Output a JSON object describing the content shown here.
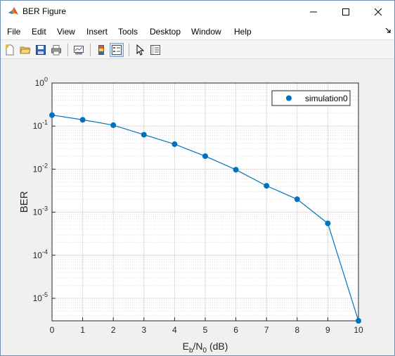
{
  "window": {
    "title": "BER Figure"
  },
  "menu": [
    "File",
    "Edit",
    "View",
    "Insert",
    "Tools",
    "Desktop",
    "Window",
    "Help"
  ],
  "toolbar": [
    "new-figure-icon",
    "open-file-icon",
    "save-icon",
    "print-icon",
    "link-plot-icon",
    "colorbar-icon",
    "legend-icon",
    "pointer-icon",
    "property-inspector-icon"
  ],
  "colors": {
    "series": "#0072bd",
    "grid": "#dcdcdc"
  },
  "chart_data": {
    "type": "line",
    "xlabel": "E_b/N_0 (dB)",
    "xlabel_parts": {
      "e": "E",
      "b": "b",
      "slash": "/N",
      "zero": "0",
      "unit": " (dB)"
    },
    "ylabel": "BER",
    "yscale": "log",
    "xlim": [
      0,
      10
    ],
    "ylim": [
      3e-06,
      1
    ],
    "xticks": [
      "0",
      "1",
      "2",
      "3",
      "4",
      "5",
      "6",
      "7",
      "8",
      "9",
      "10"
    ],
    "yticks": [
      {
        "base": "10",
        "exp": "0",
        "value": 1
      },
      {
        "base": "10",
        "exp": "-1",
        "value": 0.1
      },
      {
        "base": "10",
        "exp": "-2",
        "value": 0.01
      },
      {
        "base": "10",
        "exp": "-3",
        "value": 0.001
      },
      {
        "base": "10",
        "exp": "-4",
        "value": 0.0001
      },
      {
        "base": "10",
        "exp": "-5",
        "value": 1e-05
      }
    ],
    "grid": true,
    "legend_position": "top-right",
    "series": [
      {
        "name": "simulation0",
        "x": [
          0,
          1,
          2,
          3,
          4,
          5,
          6,
          7,
          8,
          9,
          10
        ],
        "y": [
          0.18,
          0.14,
          0.105,
          0.063,
          0.038,
          0.02,
          0.0097,
          0.0041,
          0.002,
          0.00055,
          3e-06
        ]
      }
    ]
  }
}
